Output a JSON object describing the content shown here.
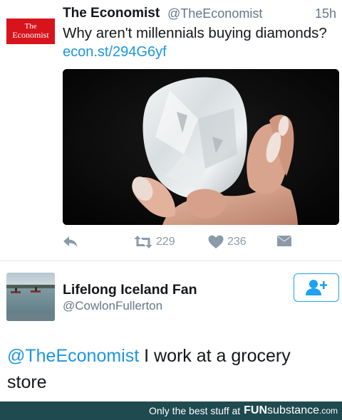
{
  "tweet": {
    "avatar": {
      "line1": "The",
      "line2": "Economist",
      "brand_color": "#d7131b"
    },
    "author_name": "The Economist",
    "author_handle": "@TheEconomist",
    "timestamp": "15h",
    "text": "Why aren't millennials buying diamonds?",
    "link": "econ.st/294G6yf",
    "media": {
      "description_icon": "photo-diamond-in-hand"
    },
    "actions": {
      "reply_icon": "reply-icon",
      "retweet_icon": "retweet-icon",
      "retweet_count": "229",
      "like_icon": "heart-icon",
      "like_count": "236",
      "dm_icon": "envelope-icon"
    }
  },
  "reply": {
    "author_name": "Lifelong Iceland Fan",
    "author_handle": "@CowlonFullerton",
    "follow_icon": "add-user-icon",
    "mention": "@TheEconomist",
    "text": " I work at a grocery store"
  },
  "watermark": {
    "prefix": "Only the best stuff at",
    "brand_fun": "FUN",
    "brand_sub": "substance",
    "brand_dom": ".com"
  },
  "colors": {
    "link": "#1b95e0",
    "secondary_text": "#657786",
    "action_gray": "#8a9aa8",
    "footer_bg": "#1f4a50"
  }
}
